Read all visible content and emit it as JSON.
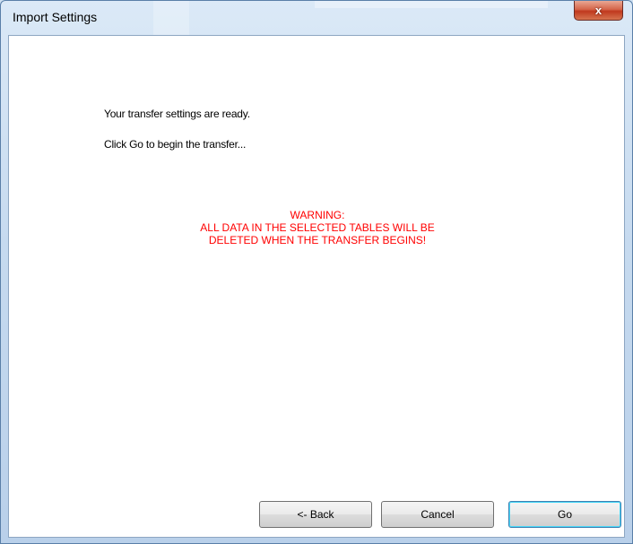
{
  "window": {
    "title": "Import Settings",
    "close_symbol": "x"
  },
  "content": {
    "line1": "Your transfer settings are ready.",
    "line2": "Click Go to begin the transfer...",
    "warning": {
      "heading": "WARNING:",
      "line1": "ALL DATA IN THE SELECTED TABLES WILL BE",
      "line2": "DELETED WHEN THE TRANSFER BEGINS!",
      "color": "#ff0000"
    }
  },
  "buttons": {
    "back": "<- Back",
    "cancel": "Cancel",
    "go": "Go"
  }
}
